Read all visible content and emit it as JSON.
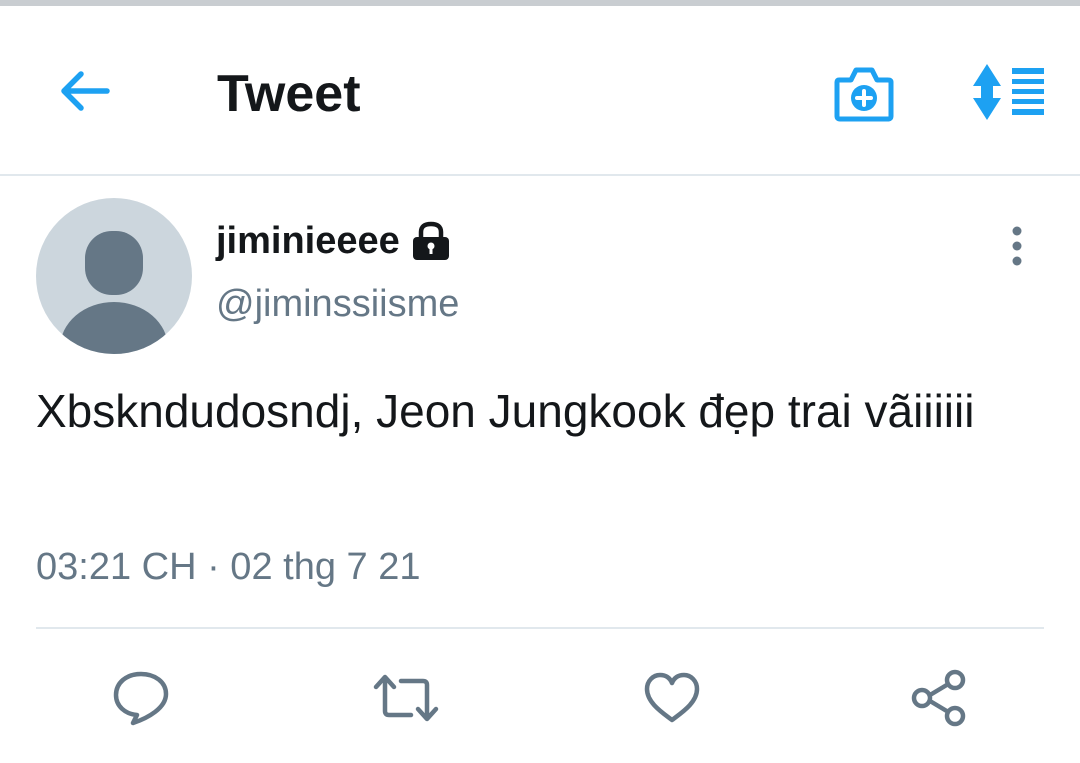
{
  "header": {
    "title": "Tweet",
    "back_icon": "arrow-left-icon",
    "camera_icon": "camera-plus-icon",
    "sort_icon": "sort-list-icon",
    "accent_color": "#1da1f2"
  },
  "tweet": {
    "display_name": "jiminieeee",
    "protected_icon": "lock-icon",
    "handle": "@jiminssiisme",
    "text": "Xbskndudosndj, Jeon Jungkook đẹp trai vãiiiiii",
    "timestamp": "03:21 CH · 02 thg 7 21",
    "more_icon": "vertical-dots-icon"
  },
  "actions": [
    {
      "name": "reply",
      "icon": "reply-icon"
    },
    {
      "name": "retweet",
      "icon": "retweet-icon"
    },
    {
      "name": "like",
      "icon": "heart-icon"
    },
    {
      "name": "share",
      "icon": "share-icon"
    }
  ],
  "colors": {
    "text_primary": "#14171a",
    "text_secondary": "#657786",
    "divider": "#e1e8ed",
    "avatar_bg": "#ccd6dd",
    "avatar_fg": "#657786"
  }
}
